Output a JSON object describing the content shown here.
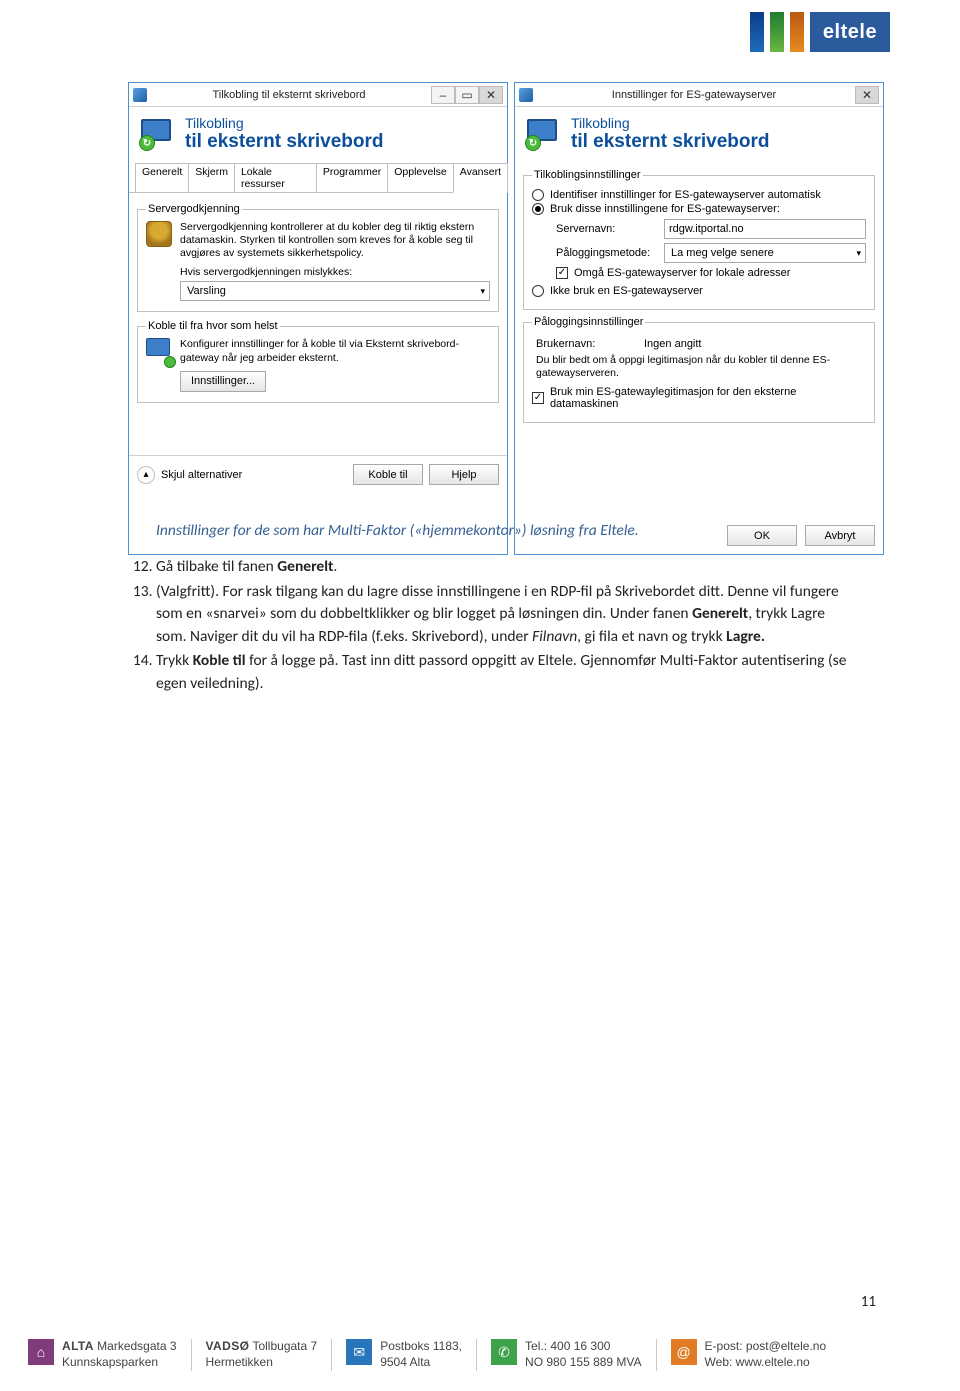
{
  "header_logo_text": "eltele",
  "win_left": {
    "title": "Tilkobling til eksternt skrivebord",
    "banner_line1": "Tilkobling",
    "banner_line2": "til eksternt skrivebord",
    "tabs": [
      "Generelt",
      "Skjerm",
      "Lokale ressurser",
      "Programmer",
      "Opplevelse",
      "Avansert"
    ],
    "active_tab": 5,
    "group1": {
      "legend": "Servergodkjenning",
      "desc": "Servergodkjenning kontrollerer at du kobler deg til riktig ekstern datamaskin. Styrken til kontrollen som kreves for å koble seg til avgjøres av systemets sikkerhetspolicy.",
      "sub_label": "Hvis servergodkjenningen mislykkes:",
      "select_value": "Varsling"
    },
    "group2": {
      "legend": "Koble til fra hvor som helst",
      "desc": "Konfigurer innstillinger for å koble til via Eksternt skrivebord-gateway når jeg arbeider eksternt.",
      "btn": "Innstillinger..."
    },
    "footer": {
      "hide": "Skjul alternativer",
      "connect": "Koble til",
      "help": "Hjelp"
    }
  },
  "win_right": {
    "title": "Innstillinger for ES-gatewayserver",
    "banner_line1": "Tilkobling",
    "banner_line2": "til eksternt skrivebord",
    "group1": {
      "legend": "Tilkoblingsinnstillinger",
      "radio_auto": "Identifiser innstillinger for ES-gatewayserver automatisk",
      "radio_use": "Bruk disse innstillingene for ES-gatewayserver:",
      "server_label": "Servernavn:",
      "server_value": "rdgw.itportal.no",
      "login_label": "Påloggingsmetode:",
      "login_value": "La meg velge senere",
      "chk_bypass": "Omgå ES-gatewayserver for lokale adresser",
      "radio_none": "Ikke bruk en ES-gatewayserver"
    },
    "group2": {
      "legend": "Påloggingsinnstillinger",
      "user_label": "Brukernavn:",
      "user_value": "Ingen angitt",
      "note": "Du blir bedt om å oppgi legitimasjon når du kobler til denne ES-gatewayserveren.",
      "chk_cred": "Bruk min ES-gatewaylegitimasjon for den eksterne datamaskinen"
    },
    "buttons": {
      "ok": "OK",
      "cancel": "Avbryt"
    }
  },
  "body": {
    "caption": "Innstillinger for de som har Multi-Faktor («hjemmekontor») løsning fra Eltele.",
    "step12_num": "12.",
    "step12_a": "Gå tilbake til fanen ",
    "step12_b": "Generelt",
    "step12_c": ".",
    "step13_num": "13.",
    "step13_a": "(Valgfritt). For rask tilgang kan du lagre disse innstillingene i en RDP-fil på Skrivebordet ditt. Denne vil fungere som en «snarvei» som du dobbeltklikker og blir logget på løsningen din. Under fanen ",
    "step13_b": "Generelt",
    "step13_c": ", trykk Lagre som. Naviger dit du vil ha RDP-fila (f.eks. Skrivebord), under ",
    "step13_d": "Filnavn",
    "step13_e": ", gi fila et navn og trykk ",
    "step13_f": "Lagre.",
    "step14_num": "14.",
    "step14_a": "Trykk ",
    "step14_b": "Koble til",
    "step14_c": " for å logge på. Tast inn ditt passord oppgitt av Eltele. Gjennomfør Multi-Faktor autentisering (se egen veiledning)."
  },
  "page_number": "11",
  "footer": {
    "alta": {
      "title": "ALTA",
      "line1": "Markedsgata 3",
      "line2": "Kunnskapsparken"
    },
    "vadso": {
      "title": "VADSØ",
      "line1": "Tollbugata 7",
      "line2": "Hermetikken"
    },
    "post": {
      "line1": "Postboks 1183,",
      "line2": "9504 Alta"
    },
    "tel": {
      "line1": "Tel.: 400 16 300",
      "line2": "NO 980 155 889 MVA"
    },
    "mail": {
      "line1": "E-post: post@eltele.no",
      "line2": "Web: www.eltele.no"
    }
  }
}
